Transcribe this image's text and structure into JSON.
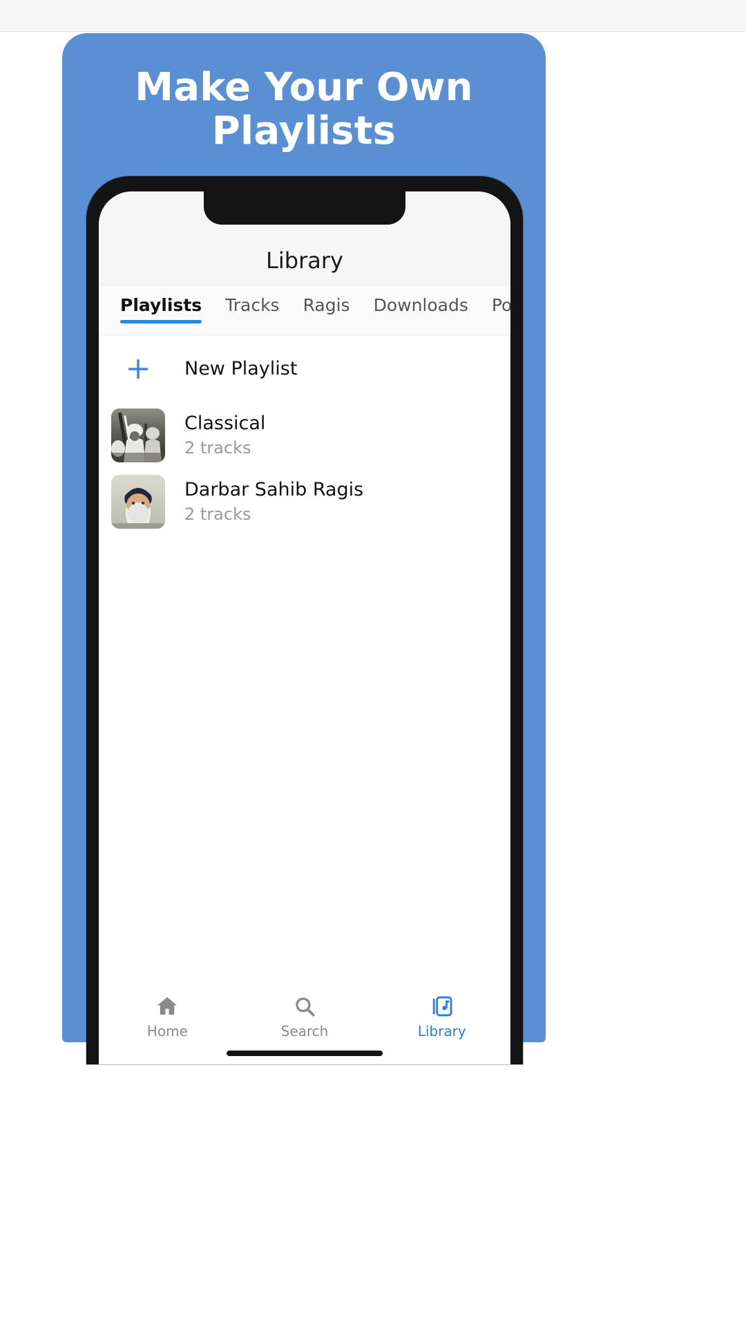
{
  "promo": {
    "title_line1": "Make Your Own",
    "title_line2": "Playlists",
    "background_color": "#5b8fd4",
    "text_color": "#ffffff"
  },
  "phone": {
    "nav": {
      "title": "Library"
    },
    "tabs": [
      {
        "label": "Playlists",
        "active": true
      },
      {
        "label": "Tracks",
        "active": false
      },
      {
        "label": "Ragis",
        "active": false
      },
      {
        "label": "Downloads",
        "active": false
      },
      {
        "label": "Podcasts",
        "active": false
      }
    ],
    "tab_indicator_color": "#1e88e5",
    "list": {
      "new_playlist": {
        "icon": "plus-icon",
        "label": "New Playlist",
        "icon_color": "#3f85d8"
      },
      "playlists": [
        {
          "title": "Classical",
          "subtitle": "2 tracks",
          "thumbnail": "black-and-white-musicians-photo"
        },
        {
          "title": "Darbar Sahib Ragis",
          "subtitle": "2 tracks",
          "thumbnail": "portrait-of-turbaned-man-photo"
        }
      ]
    },
    "bottom_nav": [
      {
        "label": "Home",
        "icon": "home-icon",
        "active": false
      },
      {
        "label": "Search",
        "icon": "search-icon",
        "active": false
      },
      {
        "label": "Library",
        "icon": "library-icon",
        "active": true
      }
    ],
    "bottom_nav_active_color": "#2b7de0",
    "bottom_nav_inactive_color": "#8a8a8a"
  }
}
